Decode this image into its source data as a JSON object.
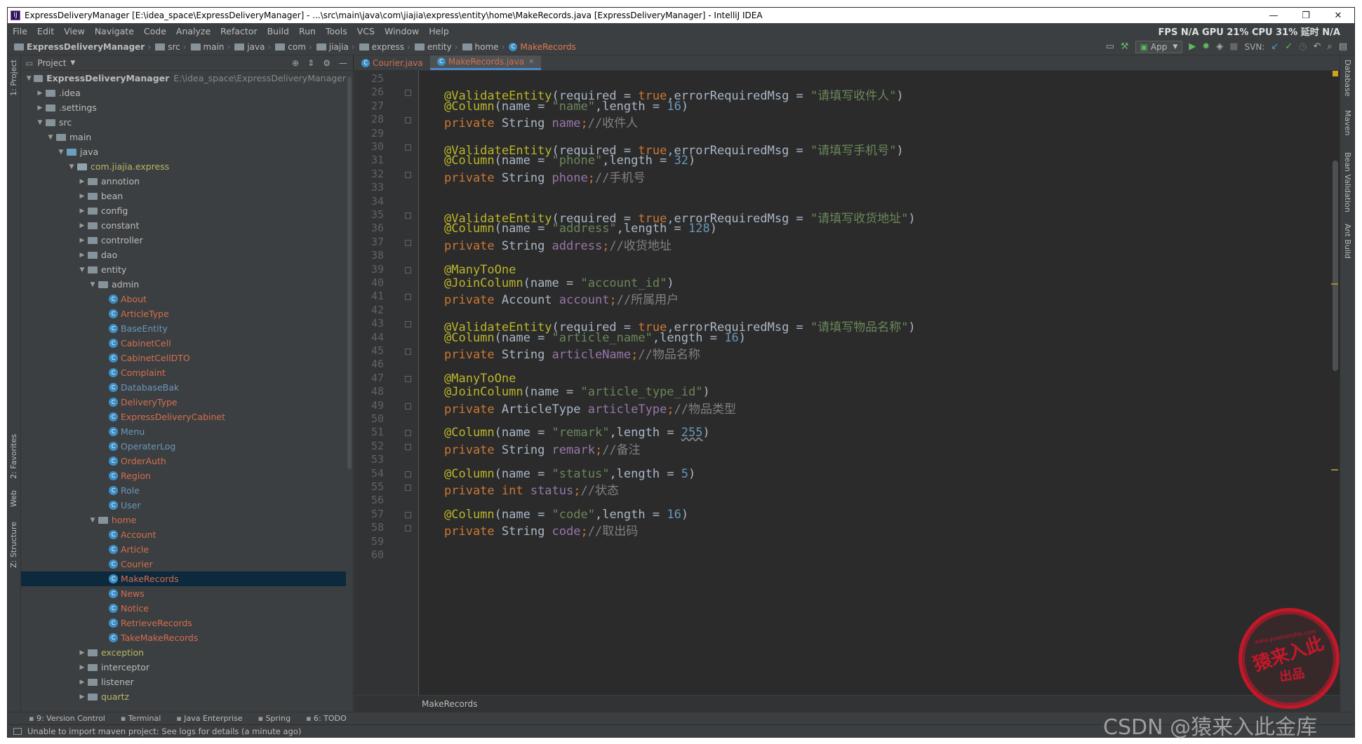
{
  "window": {
    "title": "ExpressDeliveryManager [E:\\idea_space\\ExpressDeliveryManager] - ...\\src\\main\\java\\com\\jiajia\\express\\entity\\home\\MakeRecords.java [ExpressDeliveryManager] - IntelliJ IDEA",
    "app_icon": "IJ"
  },
  "menu": [
    "File",
    "Edit",
    "View",
    "Navigate",
    "Code",
    "Analyze",
    "Refactor",
    "Build",
    "Run",
    "Tools",
    "VCS",
    "Window",
    "Help"
  ],
  "perf": "FPS N/A GPU 21% CPU 31% 延时 N/A",
  "breadcrumbs": [
    "ExpressDeliveryManager",
    "src",
    "main",
    "java",
    "com",
    "jiajia",
    "express",
    "entity",
    "home",
    "MakeRecords"
  ],
  "toolbar": {
    "run_config": "App",
    "svn_label": "SVN:"
  },
  "left_strip": {
    "project": "1: Project",
    "favorites": "2: Favorites",
    "web": "Web",
    "structure": "Z: Structure"
  },
  "right_strip": {
    "database": "Database",
    "maven": "Maven",
    "bean": "Bean Validation",
    "ant": "Ant Build"
  },
  "project_panel": {
    "title": "Project",
    "tree": [
      {
        "label": "ExpressDeliveryManager",
        "path": "E:\\idea_space\\ExpressDeliveryManager",
        "depth": 0,
        "kind": "root",
        "open": true
      },
      {
        "label": ".idea",
        "depth": 1,
        "kind": "folder",
        "open": false
      },
      {
        "label": ".settings",
        "depth": 1,
        "kind": "folder",
        "open": false
      },
      {
        "label": "src",
        "depth": 1,
        "kind": "folder",
        "open": true
      },
      {
        "label": "main",
        "depth": 2,
        "kind": "folder",
        "open": true
      },
      {
        "label": "java",
        "depth": 3,
        "kind": "src",
        "open": true
      },
      {
        "label": "com.jiajia.express",
        "depth": 4,
        "kind": "pkg",
        "open": true,
        "color": "yel"
      },
      {
        "label": "annotion",
        "depth": 5,
        "kind": "folder",
        "open": false
      },
      {
        "label": "bean",
        "depth": 5,
        "kind": "folder",
        "open": false
      },
      {
        "label": "config",
        "depth": 5,
        "kind": "folder",
        "open": false
      },
      {
        "label": "constant",
        "depth": 5,
        "kind": "folder",
        "open": false
      },
      {
        "label": "controller",
        "depth": 5,
        "kind": "folder",
        "open": false
      },
      {
        "label": "dao",
        "depth": 5,
        "kind": "folder",
        "open": false
      },
      {
        "label": "entity",
        "depth": 5,
        "kind": "folder",
        "open": true
      },
      {
        "label": "admin",
        "depth": 6,
        "kind": "folder",
        "open": true
      },
      {
        "label": "About",
        "depth": 7,
        "kind": "class",
        "color": "red"
      },
      {
        "label": "ArticleType",
        "depth": 7,
        "kind": "class",
        "color": "red"
      },
      {
        "label": "BaseEntity",
        "depth": 7,
        "kind": "class",
        "color": "blu"
      },
      {
        "label": "CabinetCell",
        "depth": 7,
        "kind": "class",
        "color": "red"
      },
      {
        "label": "CabinetCellDTO",
        "depth": 7,
        "kind": "class",
        "color": "red"
      },
      {
        "label": "Complaint",
        "depth": 7,
        "kind": "class",
        "color": "red"
      },
      {
        "label": "DatabaseBak",
        "depth": 7,
        "kind": "class",
        "color": "blu"
      },
      {
        "label": "DeliveryType",
        "depth": 7,
        "kind": "class",
        "color": "red"
      },
      {
        "label": "ExpressDeliveryCabinet",
        "depth": 7,
        "kind": "class",
        "color": "red"
      },
      {
        "label": "Menu",
        "depth": 7,
        "kind": "class",
        "color": "blu"
      },
      {
        "label": "OperaterLog",
        "depth": 7,
        "kind": "class",
        "color": "blu"
      },
      {
        "label": "OrderAuth",
        "depth": 7,
        "kind": "class",
        "color": "red"
      },
      {
        "label": "Region",
        "depth": 7,
        "kind": "class",
        "color": "red"
      },
      {
        "label": "Role",
        "depth": 7,
        "kind": "class",
        "color": "blu"
      },
      {
        "label": "User",
        "depth": 7,
        "kind": "class",
        "color": "blu"
      },
      {
        "label": "home",
        "depth": 6,
        "kind": "folder",
        "open": true,
        "color": "red"
      },
      {
        "label": "Account",
        "depth": 7,
        "kind": "class",
        "color": "red"
      },
      {
        "label": "Article",
        "depth": 7,
        "kind": "class",
        "color": "red"
      },
      {
        "label": "Courier",
        "depth": 7,
        "kind": "class",
        "color": "red"
      },
      {
        "label": "MakeRecords",
        "depth": 7,
        "kind": "class",
        "color": "red",
        "selected": true
      },
      {
        "label": "News",
        "depth": 7,
        "kind": "class",
        "color": "red"
      },
      {
        "label": "Notice",
        "depth": 7,
        "kind": "class",
        "color": "red"
      },
      {
        "label": "RetrieveRecords",
        "depth": 7,
        "kind": "class",
        "color": "red"
      },
      {
        "label": "TakeMakeRecords",
        "depth": 7,
        "kind": "class",
        "color": "red"
      },
      {
        "label": "exception",
        "depth": 5,
        "kind": "folder",
        "open": false,
        "color": "yel"
      },
      {
        "label": "interceptor",
        "depth": 5,
        "kind": "folder",
        "open": false
      },
      {
        "label": "listener",
        "depth": 5,
        "kind": "folder",
        "open": false
      },
      {
        "label": "quartz",
        "depth": 5,
        "kind": "folder",
        "open": false,
        "color": "yel"
      }
    ]
  },
  "tabs": [
    {
      "label": "Courier.java",
      "active": false
    },
    {
      "label": "MakeRecords.java",
      "active": true
    }
  ],
  "code": {
    "first_line": 25,
    "lines": [
      [],
      [
        [
          "ann",
          "@ValidateEntity"
        ],
        [
          "p",
          "(required = "
        ],
        [
          "kw",
          "true"
        ],
        [
          "p",
          ",errorRequiredMsg = "
        ],
        [
          "str",
          "\"请填写收件人\""
        ],
        [
          "p",
          ")"
        ]
      ],
      [
        [
          "ann",
          "@Column"
        ],
        [
          "p",
          "(name = "
        ],
        [
          "str",
          "\"name\""
        ],
        [
          "p",
          ",length = "
        ],
        [
          "num",
          "16"
        ],
        [
          "p",
          ")"
        ]
      ],
      [
        [
          "kw",
          "private "
        ],
        [
          "p",
          "String "
        ],
        [
          "fld",
          "name"
        ],
        [
          "kw",
          ";"
        ],
        [
          "cmt",
          "//收件人"
        ]
      ],
      [],
      [
        [
          "ann",
          "@ValidateEntity"
        ],
        [
          "p",
          "(required = "
        ],
        [
          "kw",
          "true"
        ],
        [
          "p",
          ",errorRequiredMsg = "
        ],
        [
          "str",
          "\"请填写手机号\""
        ],
        [
          "p",
          ")"
        ]
      ],
      [
        [
          "ann",
          "@Column"
        ],
        [
          "p",
          "(name = "
        ],
        [
          "str",
          "\"phone\""
        ],
        [
          "p",
          ",length = "
        ],
        [
          "num",
          "32"
        ],
        [
          "p",
          ")"
        ]
      ],
      [
        [
          "kw",
          "private "
        ],
        [
          "p",
          "String "
        ],
        [
          "fld",
          "phone"
        ],
        [
          "kw",
          ";"
        ],
        [
          "cmt",
          "//手机号"
        ]
      ],
      [],
      [],
      [
        [
          "ann",
          "@ValidateEntity"
        ],
        [
          "p",
          "(required = "
        ],
        [
          "kw",
          "true"
        ],
        [
          "p",
          ",errorRequiredMsg = "
        ],
        [
          "str",
          "\"请填写收货地址\""
        ],
        [
          "p",
          ")"
        ]
      ],
      [
        [
          "ann",
          "@Column"
        ],
        [
          "p",
          "(name = "
        ],
        [
          "str",
          "\"address\""
        ],
        [
          "p",
          ",length = "
        ],
        [
          "num",
          "128"
        ],
        [
          "p",
          ")"
        ]
      ],
      [
        [
          "kw",
          "private "
        ],
        [
          "p",
          "String "
        ],
        [
          "fld",
          "address"
        ],
        [
          "kw",
          ";"
        ],
        [
          "cmt",
          "//收货地址"
        ]
      ],
      [],
      [
        [
          "ann",
          "@ManyToOne"
        ]
      ],
      [
        [
          "ann",
          "@JoinColumn"
        ],
        [
          "p",
          "(name = "
        ],
        [
          "str",
          "\"account_id\""
        ],
        [
          "p",
          ")"
        ]
      ],
      [
        [
          "kw",
          "private "
        ],
        [
          "p",
          "Account "
        ],
        [
          "fld",
          "account"
        ],
        [
          "kw",
          ";"
        ],
        [
          "cmt",
          "//所属用户"
        ]
      ],
      [],
      [
        [
          "ann",
          "@ValidateEntity"
        ],
        [
          "p",
          "(required = "
        ],
        [
          "kw",
          "true"
        ],
        [
          "p",
          ",errorRequiredMsg = "
        ],
        [
          "str",
          "\"请填写物品名称\""
        ],
        [
          "p",
          ")"
        ]
      ],
      [
        [
          "ann",
          "@Column"
        ],
        [
          "p",
          "(name = "
        ],
        [
          "str",
          "\"article_name\""
        ],
        [
          "p",
          ",length = "
        ],
        [
          "num",
          "16"
        ],
        [
          "p",
          ")"
        ]
      ],
      [
        [
          "kw",
          "private "
        ],
        [
          "p",
          "String "
        ],
        [
          "fld",
          "articleName"
        ],
        [
          "kw",
          ";"
        ],
        [
          "cmt",
          "//物品名称"
        ]
      ],
      [],
      [
        [
          "ann",
          "@ManyToOne"
        ]
      ],
      [
        [
          "ann",
          "@JoinColumn"
        ],
        [
          "p",
          "(name = "
        ],
        [
          "str",
          "\"article_type_id\""
        ],
        [
          "p",
          ")"
        ]
      ],
      [
        [
          "kw",
          "private "
        ],
        [
          "p",
          "ArticleType "
        ],
        [
          "fld",
          "articleType"
        ],
        [
          "kw",
          ";"
        ],
        [
          "cmt",
          "//物品类型"
        ]
      ],
      [],
      [
        [
          "ann",
          "@Column"
        ],
        [
          "p",
          "(name = "
        ],
        [
          "str",
          "\"remark\""
        ],
        [
          "p",
          ",length = "
        ],
        [
          "und",
          "255"
        ],
        [
          "p",
          ")"
        ]
      ],
      [
        [
          "kw",
          "private "
        ],
        [
          "p",
          "String "
        ],
        [
          "fld",
          "remark"
        ],
        [
          "kw",
          ";"
        ],
        [
          "cmt",
          "//备注"
        ]
      ],
      [],
      [
        [
          "ann",
          "@Column"
        ],
        [
          "p",
          "(name = "
        ],
        [
          "str",
          "\"status\""
        ],
        [
          "p",
          ",length = "
        ],
        [
          "num",
          "5"
        ],
        [
          "p",
          ")"
        ]
      ],
      [
        [
          "kw",
          "private int "
        ],
        [
          "fld",
          "status"
        ],
        [
          "kw",
          ";"
        ],
        [
          "cmt",
          "//状态"
        ]
      ],
      [],
      [
        [
          "ann",
          "@Column"
        ],
        [
          "p",
          "(name = "
        ],
        [
          "str",
          "\"code\""
        ],
        [
          "p",
          ",length = "
        ],
        [
          "num",
          "16"
        ],
        [
          "p",
          ")"
        ]
      ],
      [
        [
          "kw",
          "private "
        ],
        [
          "p",
          "String "
        ],
        [
          "fld",
          "code"
        ],
        [
          "kw",
          ";"
        ],
        [
          "cmt",
          "//取出码"
        ]
      ],
      [],
      []
    ],
    "fold_lines": [
      26,
      28,
      30,
      32,
      35,
      37,
      39,
      41,
      43,
      45,
      47,
      49,
      51,
      52,
      54,
      55,
      57,
      58
    ]
  },
  "editor_breadcrumb": "MakeRecords",
  "tool_windows": [
    "9: Version Control",
    "Terminal",
    "Java Enterprise",
    "Spring",
    "6: TODO"
  ],
  "status_message": "Unable to import maven project: See logs for details (a minute ago)",
  "watermark": {
    "stamp_top": "www.yuanrenzhe.com",
    "stamp_main": "猿来入此",
    "stamp_sub": "出品",
    "csdn": "CSDN @猿来入此金库"
  },
  "colors": {
    "annotation": "#bbb529",
    "keyword": "#cc7832",
    "string": "#6a8759",
    "number": "#6897bb",
    "field": "#9876aa",
    "comment": "#808080",
    "selection": "#0d293e"
  }
}
